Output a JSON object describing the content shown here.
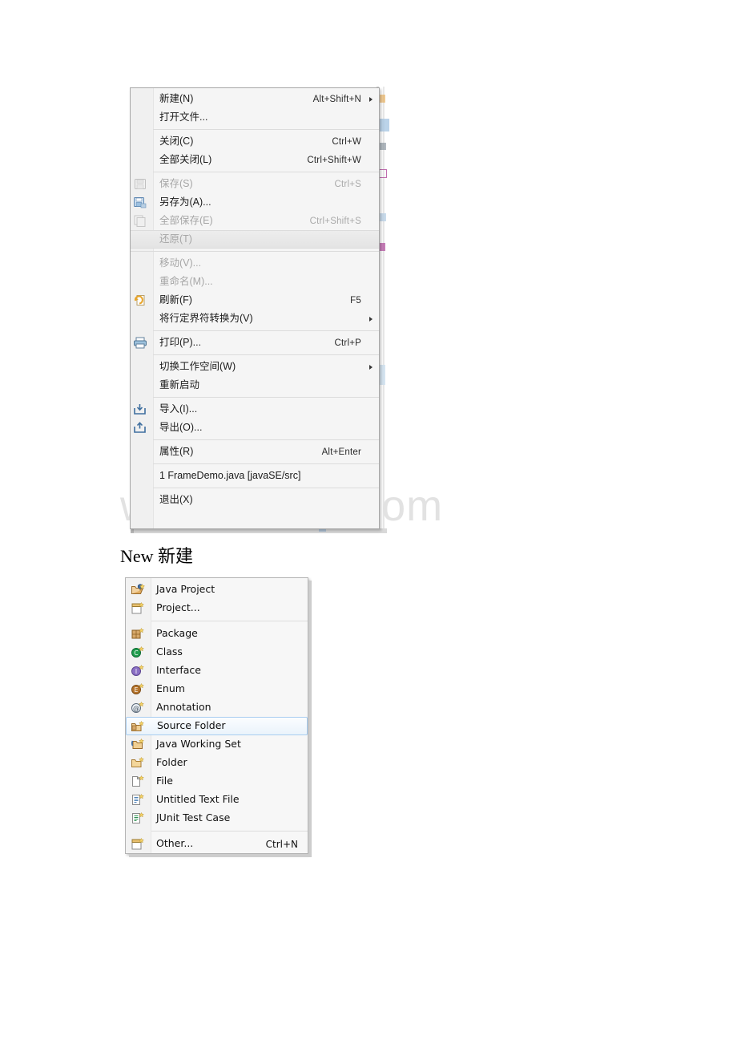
{
  "watermark": {
    "text": "www.bdocx.com",
    "color": "#e2e2e2"
  },
  "heading": {
    "text": "New 新建"
  },
  "file_menu": {
    "name": "eclipse-file-menu",
    "groups": [
      {
        "items": [
          {
            "label": "新建(N)",
            "accel": "Alt+Shift+N",
            "submenu": true,
            "disabled": false,
            "icon": ""
          },
          {
            "label": "打开文件...",
            "accel": "",
            "submenu": false,
            "disabled": false,
            "icon": ""
          }
        ]
      },
      {
        "items": [
          {
            "label": "关闭(C)",
            "accel": "Ctrl+W",
            "submenu": false,
            "disabled": false,
            "icon": ""
          },
          {
            "label": "全部关闭(L)",
            "accel": "Ctrl+Shift+W",
            "submenu": false,
            "disabled": false,
            "icon": ""
          }
        ]
      },
      {
        "items": [
          {
            "label": "保存(S)",
            "accel": "Ctrl+S",
            "submenu": false,
            "disabled": true,
            "icon": "save-icon-disabled"
          },
          {
            "label": "另存为(A)...",
            "accel": "",
            "submenu": false,
            "disabled": false,
            "icon": "save-as-icon"
          },
          {
            "label": "全部保存(E)",
            "accel": "Ctrl+Shift+S",
            "submenu": false,
            "disabled": true,
            "icon": "save-all-icon-disabled"
          },
          {
            "label": "还原(T)",
            "accel": "",
            "submenu": false,
            "disabled": true,
            "hover": true,
            "icon": ""
          }
        ]
      },
      {
        "items": [
          {
            "label": "移动(V)...",
            "accel": "",
            "submenu": false,
            "disabled": true,
            "icon": ""
          },
          {
            "label": "重命名(M)...",
            "accel": "",
            "submenu": false,
            "disabled": true,
            "icon": ""
          },
          {
            "label": "刷新(F)",
            "accel": "F5",
            "submenu": false,
            "disabled": false,
            "icon": "refresh-icon"
          },
          {
            "label": "将行定界符转换为(V)",
            "accel": "",
            "submenu": true,
            "disabled": false,
            "icon": ""
          }
        ]
      },
      {
        "items": [
          {
            "label": "打印(P)...",
            "accel": "Ctrl+P",
            "submenu": false,
            "disabled": false,
            "icon": "print-icon"
          }
        ]
      },
      {
        "items": [
          {
            "label": "切换工作空间(W)",
            "accel": "",
            "submenu": true,
            "disabled": false,
            "icon": ""
          },
          {
            "label": "重新启动",
            "accel": "",
            "submenu": false,
            "disabled": false,
            "icon": ""
          }
        ]
      },
      {
        "items": [
          {
            "label": "导入(I)...",
            "accel": "",
            "submenu": false,
            "disabled": false,
            "icon": "import-icon"
          },
          {
            "label": "导出(O)...",
            "accel": "",
            "submenu": false,
            "disabled": false,
            "icon": "export-icon"
          }
        ]
      },
      {
        "items": [
          {
            "label": "属性(R)",
            "accel": "Alt+Enter",
            "submenu": false,
            "disabled": false,
            "icon": ""
          }
        ]
      },
      {
        "items": [
          {
            "label": "1 FrameDemo.java  [javaSE/src]",
            "accel": "",
            "submenu": false,
            "disabled": false,
            "icon": ""
          }
        ]
      },
      {
        "items": [
          {
            "label": "退出(X)",
            "accel": "",
            "submenu": false,
            "disabled": false,
            "icon": ""
          }
        ]
      }
    ]
  },
  "new_menu": {
    "name": "eclipse-new-submenu",
    "groups": [
      {
        "items": [
          {
            "label": "Java Project",
            "accel": "",
            "icon": "java-project-icon",
            "selected": false
          },
          {
            "label": "Project...",
            "accel": "",
            "icon": "project-icon",
            "selected": false
          }
        ]
      },
      {
        "items": [
          {
            "label": "Package",
            "accel": "",
            "icon": "package-icon",
            "selected": false
          },
          {
            "label": "Class",
            "accel": "",
            "icon": "class-icon",
            "selected": false
          },
          {
            "label": "Interface",
            "accel": "",
            "icon": "interface-icon",
            "selected": false
          },
          {
            "label": "Enum",
            "accel": "",
            "icon": "enum-icon",
            "selected": false
          },
          {
            "label": "Annotation",
            "accel": "",
            "icon": "annotation-icon",
            "selected": false
          },
          {
            "label": "Source Folder",
            "accel": "",
            "icon": "source-folder-icon",
            "selected": true
          },
          {
            "label": "Java Working Set",
            "accel": "",
            "icon": "java-working-set-icon",
            "selected": false
          },
          {
            "label": "Folder",
            "accel": "",
            "icon": "folder-icon",
            "selected": false
          },
          {
            "label": "File",
            "accel": "",
            "icon": "file-icon",
            "selected": false
          },
          {
            "label": "Untitled Text File",
            "accel": "",
            "icon": "text-file-icon",
            "selected": false
          },
          {
            "label": "JUnit Test Case",
            "accel": "",
            "icon": "junit-icon",
            "selected": false
          }
        ]
      },
      {
        "items": [
          {
            "label": "Other...",
            "accel": "Ctrl+N",
            "icon": "other-icon",
            "selected": false
          }
        ]
      }
    ]
  }
}
